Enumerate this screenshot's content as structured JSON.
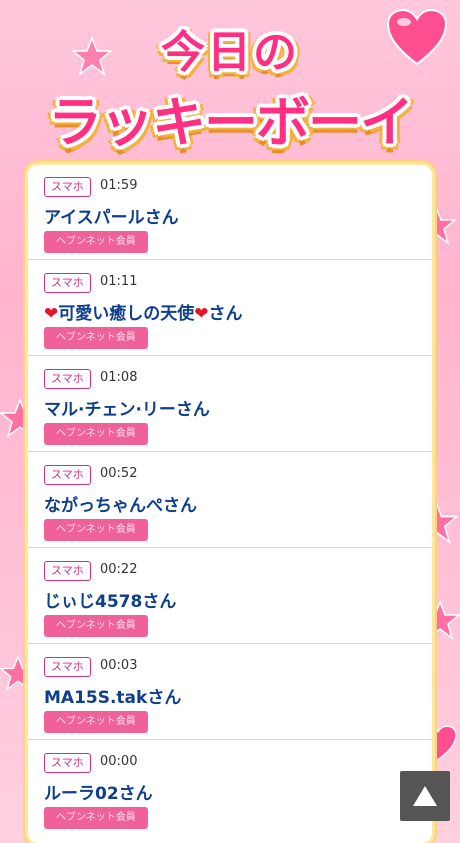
{
  "header": {
    "title_line1": "今日の",
    "title_line2": "ラッキーボーイ"
  },
  "colors": {
    "accent_pink": "#ff2f83",
    "badge_pink": "#f0619a",
    "name_blue": "#0e3f8c",
    "background_pink": "#ffb3cf"
  },
  "entries": [
    {
      "device": "スマホ",
      "time": "01:59",
      "name": "アイスパールさん",
      "badge": "ヘブンネット会員"
    },
    {
      "device": "スマホ",
      "time": "01:11",
      "name_prefix": "❤",
      "name_mid": "可愛い癒しの天使",
      "name_suffix_heart": "❤",
      "name_suffix": "さん",
      "badge": "ヘブンネット会員"
    },
    {
      "device": "スマホ",
      "time": "01:08",
      "name": "マル·チェン·リーさん",
      "badge": "ヘブンネット会員"
    },
    {
      "device": "スマホ",
      "time": "00:52",
      "name": "ながっちゃんぺさん",
      "badge": "ヘブンネット会員"
    },
    {
      "device": "スマホ",
      "time": "00:22",
      "name": "じぃじ4578さん",
      "badge": "ヘブンネット会員"
    },
    {
      "device": "スマホ",
      "time": "00:03",
      "name": "MA15S.takさん",
      "badge": "ヘブンネット会員"
    },
    {
      "device": "スマホ",
      "time": "00:00",
      "name": "ルーラ02さん",
      "badge": "ヘブンネット会員"
    }
  ],
  "scroll_top_icon": "triangle-up-icon"
}
